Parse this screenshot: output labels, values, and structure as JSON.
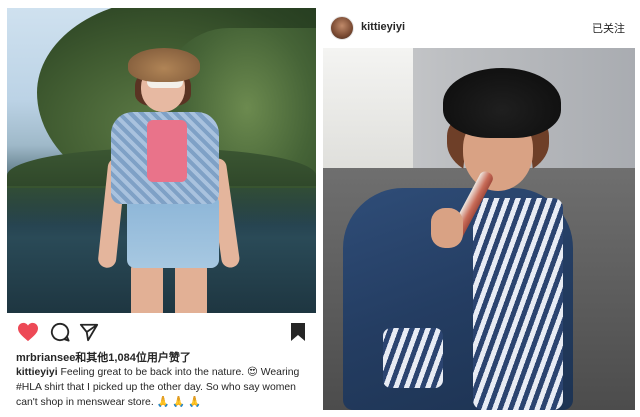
{
  "left_post": {
    "likes": "mrbriansee和其他1,084位用户赞了",
    "caption_user": "kittieyiyi",
    "caption_text": " Feeling great to be back into the nature. 😍 Wearing #HLA shirt that I picked up the other day. So who say women can't shop in menswear store. 🙏 🙏 🙏",
    "icons": [
      "heart-icon",
      "comment-icon",
      "share-icon",
      "bookmark-icon"
    ],
    "heart_color": "#ed4956"
  },
  "right_post": {
    "username": "kittieyiyi",
    "follow_status": "已关注"
  }
}
